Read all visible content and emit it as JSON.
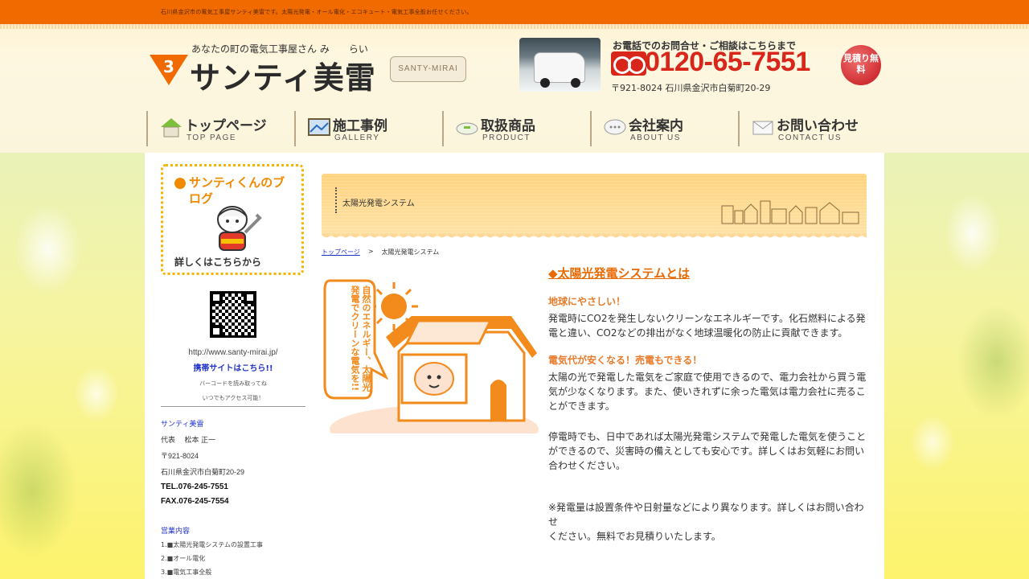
{
  "topbar": {
    "text": "石川県金沢市の電気工事屋サンティ美雷です。太陽光発電・オール電化・エコキュート・電気工事全般お任せください。"
  },
  "header": {
    "logo_sub": "あなたの町の電気工事屋さん  み　　らい",
    "logo_main": "サンティ美雷",
    "logo_badge": "SANTY-MIRAI",
    "phone_caption": "お電話でのお問合せ・ご相談はこちらまで",
    "phone_number": "0120-65-7551",
    "estimate_badge": "見積り無料",
    "address": "〒921-8024 石川県金沢市白菊町20-29"
  },
  "nav": [
    {
      "label": "トップページ",
      "sub": "TOP PAGE",
      "icon": "house-icon"
    },
    {
      "label": "施工事例",
      "sub": "GALLERY",
      "icon": "picture-icon"
    },
    {
      "label": "取扱商品",
      "sub": "PRODUCT",
      "icon": "lamp-icon"
    },
    {
      "label": "会社案内",
      "sub": "ABOUT US",
      "icon": "chat-icon"
    },
    {
      "label": "お問い合わせ",
      "sub": "CONTACT US",
      "icon": "mail-icon"
    }
  ],
  "sidebar": {
    "blog_title": "サンティくんのブログ",
    "blog_more": "詳しくはこちらから",
    "url": "http://www.santy-mirai.jp/",
    "mobile": "携帯サイトはこちら!!",
    "note1": "バーコードを読み取ってね",
    "note2": "いつでもアクセス可能！",
    "company_heading": "サンティ美雷",
    "rep": "代表　 松本 正一",
    "zip": "〒921-8024",
    "addr": "石川県金沢市白菊町20-29",
    "tel": "TEL.076-245-7551",
    "fax": "FAX.076-245-7554",
    "business_heading": "営業内容",
    "business": [
      "1.■太陽光発電システムの設置工事",
      "2.■オール電化",
      "3.■電気工事全般"
    ]
  },
  "main": {
    "page_title": "太陽光発電システム",
    "breadcrumb_home": "トップページ",
    "breadcrumb_sep": ">",
    "breadcrumb_current": "太陽光発電システム",
    "illustration_text": "自然のエネルギー、太陽光発電でクリーンな電気を!!",
    "section_title": "◆太陽光発電システムとは",
    "sub1": "地球にやさしい！",
    "para1": "発電時にCO2を発生しないクリーンなエネルギーです。化石燃料による発電と違い、CO2などの排出がなく地球温暖化の防止に貢献できます。",
    "sub2": "電気代が安くなる！売電もできる！",
    "para2": "太陽の光で発電した電気をご家庭で使用できるので、電力会社から買う電気が少なくなります。また、使いきれずに余った電気は電力会社に売ることができます。",
    "para3": "停電時でも、日中であれば太陽光発電システムで発電した電気を使うことができるので、災害時の備えとしても安心です。詳しくはお気軽にお問い合わせください。",
    "note1": "※発電量は設置条件や日射量などにより異なります。詳しくはお問い合わせ",
    "note2": "ください。無料でお見積りいたします。"
  },
  "colors": {
    "topbar": "#f06a00",
    "accent": "#e86a00",
    "link": "#2233cc",
    "phone": "#d8261b",
    "background": "#fbf56e"
  }
}
